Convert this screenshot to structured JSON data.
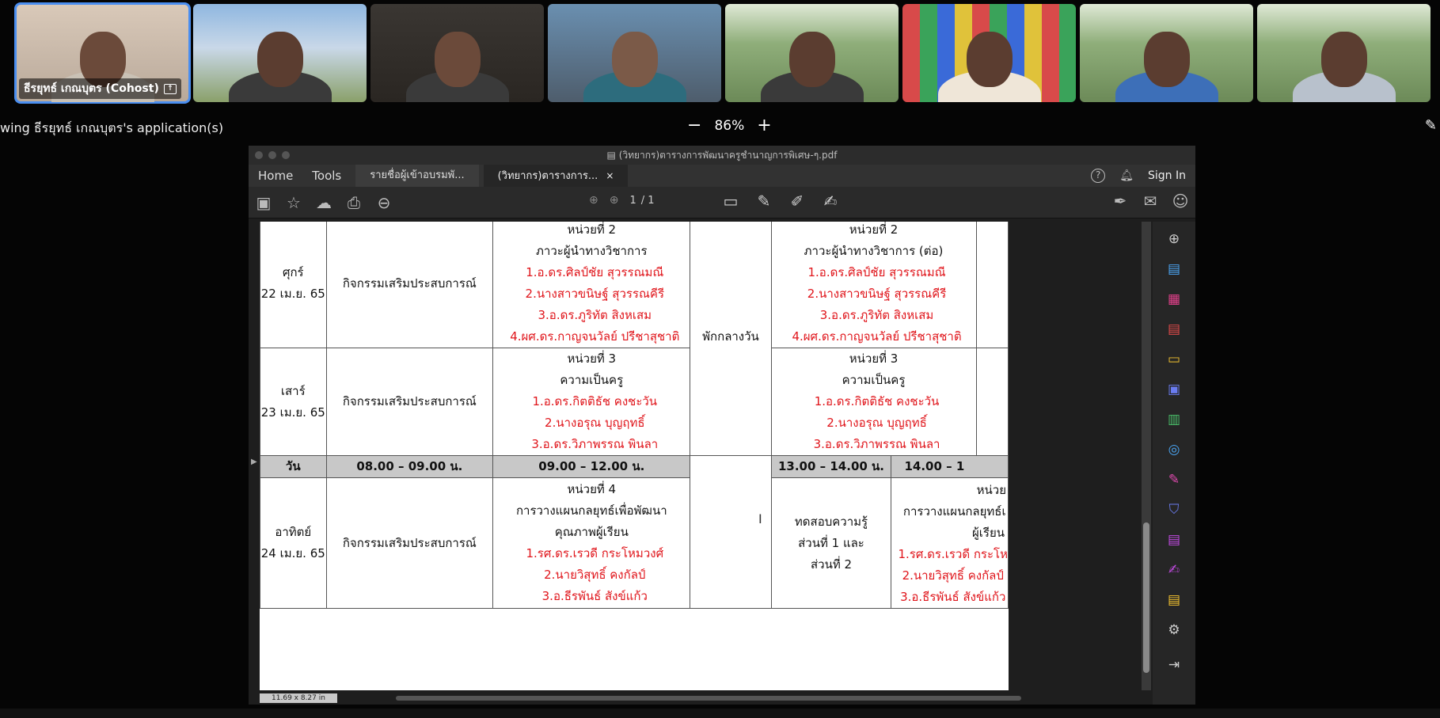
{
  "participants": [
    {
      "label": "ธีรยุทธ์ เกณบุตร (Cohost)",
      "active": true
    },
    {
      "label": ""
    },
    {
      "label": ""
    },
    {
      "label": ""
    },
    {
      "label": ""
    },
    {
      "label": ""
    },
    {
      "label": ""
    },
    {
      "label": ""
    }
  ],
  "share_bar": {
    "viewing": "wing ธีรยุทธ์ เกณบุตร's application(s)",
    "zoom_minus": "−",
    "zoom_level": "86%",
    "zoom_plus": "+"
  },
  "acrobat": {
    "window_title": "(วิทยากร)ตารางการพัฒนาครูชำนาญการพิเศษ-ๆ.pdf",
    "menu": {
      "home": "Home",
      "tools": "Tools"
    },
    "tabs": [
      {
        "label": "รายชื่อผู้เข้าอบรมพั..."
      },
      {
        "label": "(วิทยากร)ตารางการ...",
        "close": "×"
      }
    ],
    "sign_in": "Sign In",
    "help": "?",
    "page_current": "1",
    "page_total": "/ 1",
    "page_size": "11.69 x 8.27 in"
  },
  "schedule": {
    "rows": [
      {
        "day": "ศุกร์",
        "date": "22 เม.ย. 65",
        "activity": "กิจกรรมเสริมประสบการณ์",
        "unit_title": "หน่วยที่ 2",
        "unit_topic": "ภาวะผู้นำทางวิชาการ",
        "speakers": [
          "1.อ.ดร.ศิลป์ชัย  สุวรรณมณี",
          "2.นางสาวขนิษฐ์  สุวรรณคีรี",
          "3.อ.ดร.ภูริทัต  สิงหเสม",
          "4.ผศ.ดร.กาญจนวัลย์  ปรีชาสุชาติ"
        ],
        "pm_unit_title": "หน่วยที่ 2",
        "pm_unit_topic": "ภาวะผู้นำทางวิชาการ  (ต่อ)",
        "pm_speakers": [
          "1.อ.ดร.ศิลป์ชัย  สุวรรณมณี",
          "2.นางสาวขนิษฐ์  สุวรรณคีรี",
          "3.อ.ดร.ภูริทัต  สิงหเสม",
          "4.ผศ.ดร.กาญจนวัลย์  ปรีชาสุชาติ"
        ]
      },
      {
        "day": "เสาร์",
        "date": "23 เม.ย. 65",
        "activity": "กิจกรรมเสริมประสบการณ์",
        "unit_title": "หน่วยที่  3",
        "unit_topic": "ความเป็นครู",
        "speakers": [
          "1.อ.ดร.กิตติธัช คงชะวัน",
          "2.นางอรุณ บุญฤทธิ์",
          "3.อ.ดร.วิภาพรรณ  พินลา"
        ],
        "pm_unit_title": "หน่วยที่  3",
        "pm_unit_topic": "ความเป็นครู",
        "pm_speakers": [
          "1.อ.ดร.กิตติธัช คงชะวัน",
          "2.นางอรุณ บุญฤทธิ์",
          "3.อ.ดร.วิภาพรรณ  พินลา"
        ]
      }
    ],
    "lunch": "พักกลางวัน",
    "header": {
      "day": "วัน",
      "t1": "08.00 – 09.00 น.",
      "t2": "09.00 – 12.00 น.",
      "t3": "13.00 – 14.00 น.",
      "t4": "14.00 – 1"
    },
    "sunday": {
      "day": "อาทิตย์",
      "date": "24 เม.ย. 65",
      "activity": "กิจกรรมเสริมประสบการณ์",
      "unit_title": "หน่วยที่ 4",
      "unit_topic1": "การวางแผนกลยุทธ์เพื่อพัฒนา",
      "unit_topic2": "คุณภาพผู้เรียน",
      "speakers": [
        "1.รศ.ดร.เรวดี  กระโหมวงศ์",
        "2.นายวิสุทธิ์ คงกัลป์",
        "3.อ.ธีรพันธ์ สังข์แก้ว"
      ],
      "test1": "ทดสอบความรู้",
      "test2": "ส่วนที่ 1 และ",
      "test3": "ส่วนที่ 2",
      "pm_unit_title": "หน่วย",
      "pm_topic1": "การวางแผนกลยุทธ์เ",
      "pm_topic2": "ผู้เรียน",
      "pm_speakers": [
        "1.รศ.ดร.เรวดี  กระโห",
        "2.นายวิสุทธิ์ คงกัลป์",
        "3.อ.ธีรพันธ์ สังข์แก้ว"
      ]
    }
  }
}
